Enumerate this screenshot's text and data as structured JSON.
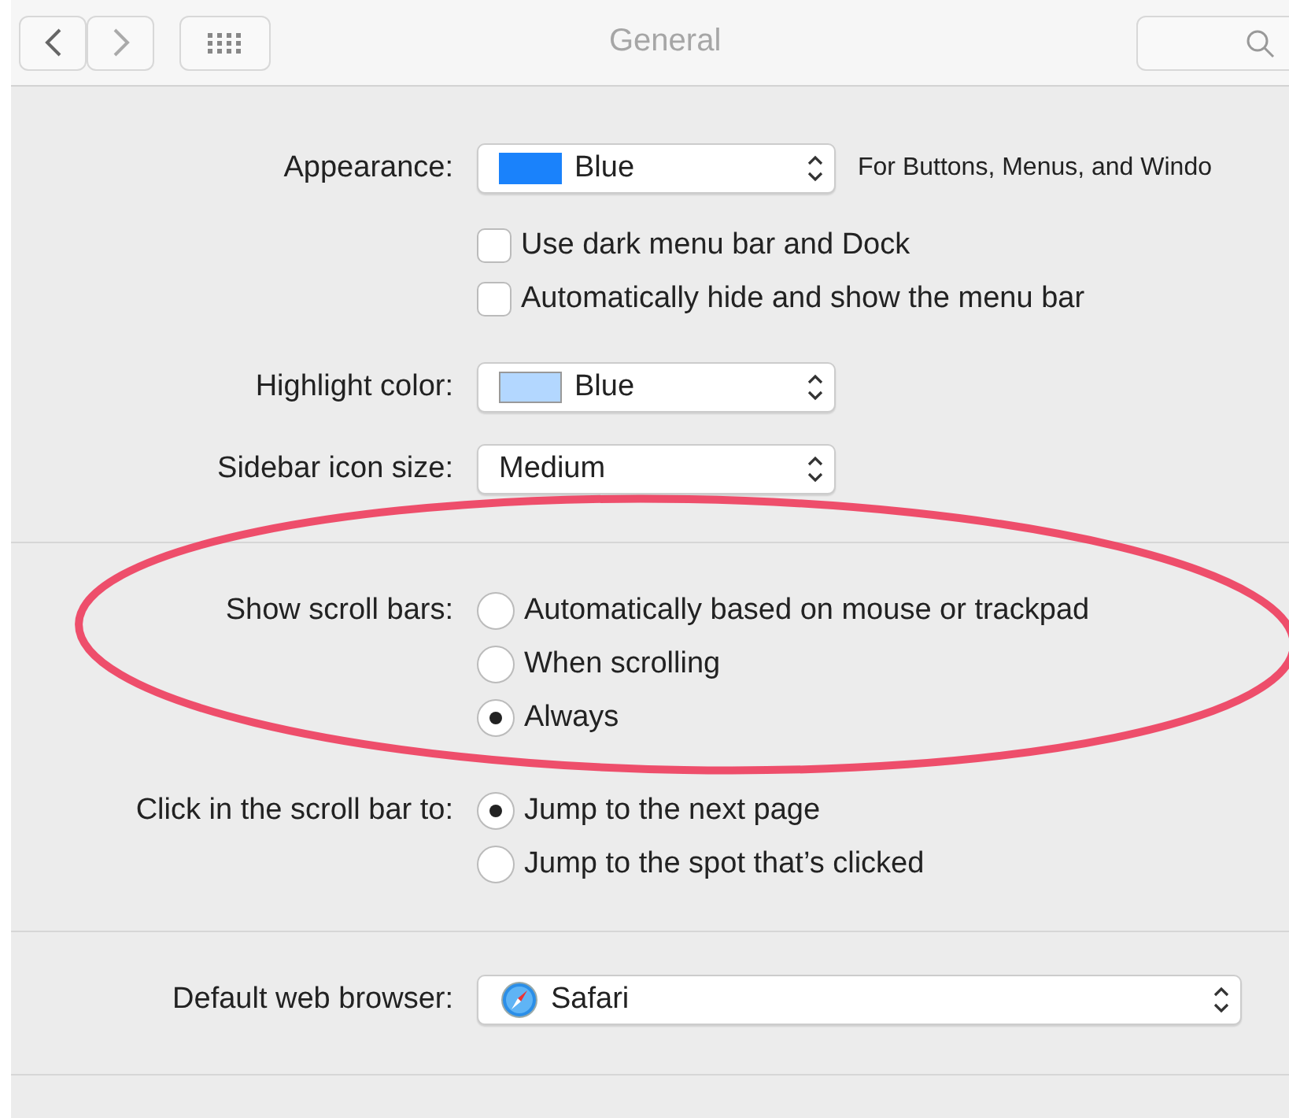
{
  "window": {
    "title": "General"
  },
  "appearance": {
    "label": "Appearance:",
    "value": "Blue",
    "color": "#1a82fb",
    "note": "For Buttons, Menus, and Windo"
  },
  "checkboxes": [
    {
      "label": "Use dark menu bar and Dock",
      "checked": false
    },
    {
      "label": "Automatically hide and show the menu bar",
      "checked": false
    }
  ],
  "highlight": {
    "label": "Highlight color:",
    "value": "Blue",
    "color": "#b3d7ff"
  },
  "sidebar_icon_size": {
    "label": "Sidebar icon size:",
    "value": "Medium"
  },
  "scroll_bars": {
    "label": "Show scroll bars:",
    "options": [
      {
        "label": "Automatically based on mouse or trackpad",
        "selected": false
      },
      {
        "label": "When scrolling",
        "selected": false
      },
      {
        "label": "Always",
        "selected": true
      }
    ]
  },
  "click_scroll_bar": {
    "label": "Click in the scroll bar to:",
    "options": [
      {
        "label": "Jump to the next page",
        "selected": true
      },
      {
        "label": "Jump to the spot that’s clicked",
        "selected": false
      }
    ]
  },
  "default_browser": {
    "label": "Default web browser:",
    "value": "Safari"
  }
}
